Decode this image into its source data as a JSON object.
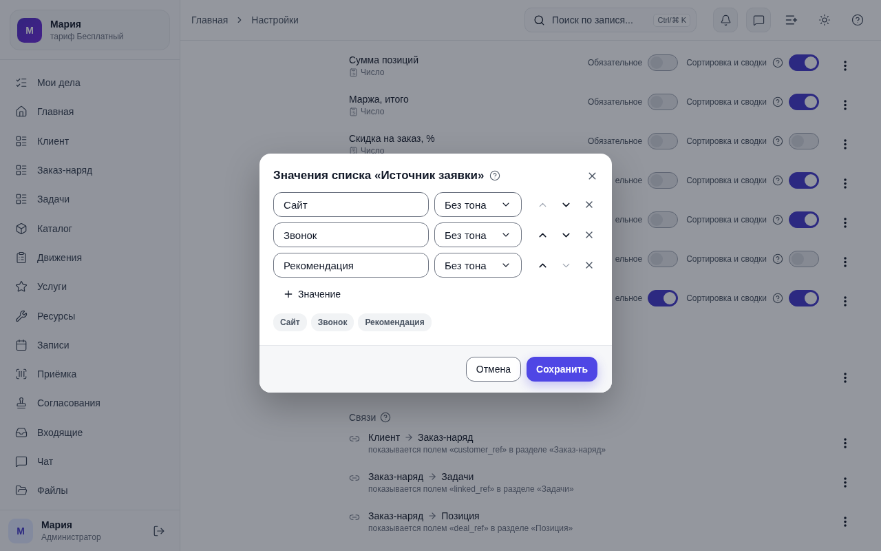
{
  "sidebar": {
    "account": {
      "avatar": "М",
      "name": "Мария",
      "plan": "тариф Бесплатный"
    },
    "items": [
      {
        "label": "Мои дела"
      },
      {
        "label": "Главная"
      },
      {
        "label": "Клиент"
      },
      {
        "label": "Заказ-наряд"
      },
      {
        "label": "Задачи"
      },
      {
        "label": "Каталог"
      },
      {
        "label": "Движения"
      },
      {
        "label": "Услуги"
      },
      {
        "label": "Ресурсы"
      },
      {
        "label": "Записи"
      },
      {
        "label": "Приёмка"
      },
      {
        "label": "Согласования"
      },
      {
        "label": "Входящие"
      },
      {
        "label": "Чат"
      },
      {
        "label": "Файлы"
      }
    ],
    "user": {
      "avatar": "М",
      "name": "Мария",
      "role": "Администратор"
    }
  },
  "header": {
    "breadcrumbs": [
      "Главная",
      "Настройки"
    ],
    "search": {
      "placeholder": "Поиск по запися...",
      "shortcut": "Ctrl/⌘ K"
    }
  },
  "fields": [
    {
      "kind": "field",
      "name": "Сумма позиций",
      "type": "Число",
      "required_label": "Обязательное",
      "required": false,
      "sort_label": "Сортировка и сводки",
      "sort": true
    },
    {
      "kind": "field",
      "name": "Маржа, итого",
      "type": "Число",
      "required_label": "Обязательное",
      "required": false,
      "sort_label": "Сортировка и сводки",
      "sort": true
    },
    {
      "kind": "field",
      "name": "Скидка на заказ, %",
      "type": "Число",
      "required_label": "Обязательное",
      "required": false,
      "sort_label": "Сортировка и сводки",
      "sort": false
    },
    {
      "kind": "covered",
      "required_label": "ельное",
      "required": false,
      "sort_label": "Сортировка и сводки",
      "sort": true
    },
    {
      "kind": "covered",
      "required_label": "ельное",
      "required": false,
      "sort_label": "Сортировка и сводки",
      "sort": true
    },
    {
      "kind": "covered",
      "required_label": "ельное",
      "required": false,
      "sort_label": "Сортировка и сводки",
      "sort": false
    },
    {
      "kind": "covered",
      "required_label": "ельное",
      "required": true,
      "sort_label": "Сортировка и сводки",
      "sort": true
    },
    {
      "kind": "menu-only"
    }
  ],
  "links": {
    "title": "Связи",
    "items": [
      {
        "from": "Клиент",
        "to": "Заказ-наряд",
        "note": "показывается полем «customer_ref» в разделе «Заказ-наряд»"
      },
      {
        "from": "Заказ-наряд",
        "to": "Задачи",
        "note": "показывается полем «linked_ref» в разделе «Задачи»"
      },
      {
        "from": "Заказ-наряд",
        "to": "Позиция",
        "note": "показывается полем «deal_ref» в разделе «Позиция»"
      }
    ]
  },
  "modal": {
    "title": "Значения списка «Источник заявки»",
    "rows": [
      {
        "value": "Сайт",
        "tone": "Без тона",
        "up_disabled": true,
        "down_disabled": false
      },
      {
        "value": "Звонок",
        "tone": "Без тона",
        "up_disabled": false,
        "down_disabled": false
      },
      {
        "value": "Рекомендация",
        "tone": "Без тона",
        "up_disabled": false,
        "down_disabled": true
      }
    ],
    "add_label": "Значение",
    "chips": [
      "Сайт",
      "Звонок",
      "Рекомендация"
    ],
    "cancel": "Отмена",
    "save": "Сохранить"
  }
}
